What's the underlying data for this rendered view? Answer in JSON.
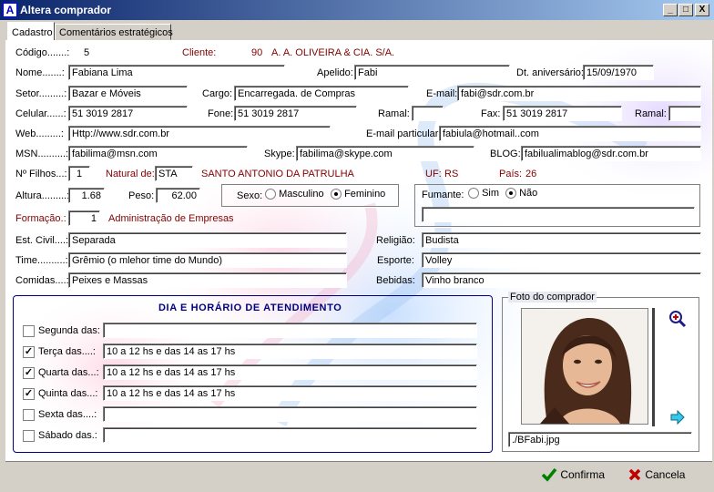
{
  "window": {
    "title": "Altera comprador",
    "min_label": "_",
    "max_label": "□",
    "close_label": "X"
  },
  "tabs": [
    {
      "label": "Cadastro",
      "active": true
    },
    {
      "label": "Comentários estratégicos",
      "active": false
    }
  ],
  "form": {
    "codigo_label": "Código.......:",
    "codigo_value": "5",
    "cliente_label": "Cliente:",
    "cliente_code": "90",
    "cliente_name": "A. A. OLIVEIRA & CIA. S/A.",
    "nome_label": "Nome.......:",
    "nome_value": "Fabiana Lima",
    "apelido_label": "Apelido:",
    "apelido_value": "Fabi",
    "dt_aniv_label": "Dt. aniversário:",
    "dt_aniv_value": "15/09/1970",
    "setor_label": "Setor.........:",
    "setor_value": "Bazar e Móveis",
    "cargo_label": "Cargo:",
    "cargo_value": "Encarregada. de Compras",
    "email_label": "E-mail:",
    "email_value": "fabi@sdr.com.br",
    "celular_label": "Celular......:",
    "celular_value": "51 3019 2817",
    "fone_label": "Fone:",
    "fone_value": "51 3019 2817",
    "ramal1_label": "Ramal:",
    "ramal1_value": "",
    "fax_label": "Fax:",
    "fax_value": "51 3019 2817",
    "ramal2_label": "Ramal:",
    "ramal2_value": "",
    "web_label": "Web.........:",
    "web_value": "Http://www.sdr.com.br",
    "email_part_label": "E-mail particular:",
    "email_part_value": "fabiula@hotmail..com",
    "msn_label": "MSN..........:",
    "msn_value": "fabilima@msn.com",
    "skype_label": "Skype:",
    "skype_value": "fabilima@skype.com",
    "blog_label": "BLOG:",
    "blog_value": "fabilualimablog@sdr.com.br",
    "filhos_label": "Nº Filhos...:",
    "filhos_value": "1",
    "natural_label": "Natural de:",
    "natural_code": "STA",
    "natural_city": "SANTO ANTONIO DA PATRULHA",
    "uf_label": "UF:",
    "uf_value": "RS",
    "pais_label": "País:",
    "pais_value": "26",
    "altura_label": "Altura.........:",
    "altura_value": "1.68",
    "peso_label": "Peso:",
    "peso_value": "62.00",
    "sexo_label": "Sexo:",
    "sexo_masc": "Masculino",
    "sexo_fem": "Feminino",
    "sexo_selected": "Feminino",
    "fumante_label": "Fumante:",
    "fumante_sim": "Sim",
    "fumante_nao": "Não",
    "fumante_selected": "Não",
    "fumante_detail": "",
    "formacao_label": "Formação.:",
    "formacao_code": "1",
    "formacao_name": "Administração de Empresas",
    "estcivil_label": "Est. Civil....:",
    "estcivil_value": "Separada",
    "religiao_label": "Religião:",
    "religiao_value": "Budista",
    "time_label": "Time..........:",
    "time_value": "Grêmio (o mlehor time do Mundo)",
    "esporte_label": "Esporte:",
    "esporte_value": "Volley",
    "comidas_label": "Comidas....:",
    "comidas_value": "Peixes e Massas",
    "bebidas_label": "Bebidas:",
    "bebidas_value": "Vinho branco"
  },
  "schedule": {
    "title": "DIA E HORÁRIO DE ATENDIMENTO",
    "days": [
      {
        "label": "Segunda das:",
        "checked": false,
        "value": ""
      },
      {
        "label": "Terça das....:",
        "checked": true,
        "value": "10 a 12 hs e das 14 as 17 hs"
      },
      {
        "label": "Quarta das...:",
        "checked": true,
        "value": "10 a 12  hs e das 14 as 17 hs"
      },
      {
        "label": "Quinta das...:",
        "checked": true,
        "value": "10 a 12 hs e das 14 as 17 hs"
      },
      {
        "label": "Sexta das....:",
        "checked": false,
        "value": ""
      },
      {
        "label": "Sábado das.:",
        "checked": false,
        "value": ""
      }
    ]
  },
  "photo": {
    "label": "Foto do comprador",
    "filename": "./BFabi.jpg"
  },
  "buttons": {
    "confirm": "Confirma",
    "cancel": "Cancela"
  },
  "colors": {
    "title_start": "#0a246a",
    "title_end": "#a6caf0",
    "label_red": "#800000",
    "schedule_title": "#000080"
  }
}
